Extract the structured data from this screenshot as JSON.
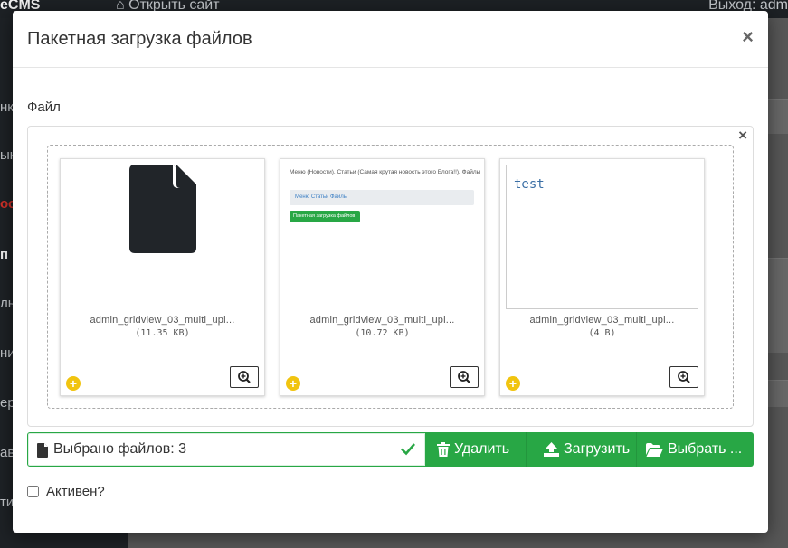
{
  "background": {
    "brand": "eCMS",
    "open_site": "Открыть сайт",
    "logout": "Выход: adm",
    "sidebar_fragments": [
      "нк",
      "ык",
      "ос",
      "п",
      "ль",
      "ни",
      "ер",
      "ав",
      "ти"
    ]
  },
  "modal": {
    "title": "Пакетная загрузка файлов",
    "close": "×"
  },
  "form": {
    "file_label": "Файл",
    "dropzone_close": "×",
    "files": [
      {
        "name": "admin_gridview_03_multi_upl...",
        "size": "(11.35 KB)",
        "preview": "file-icon"
      },
      {
        "name": "admin_gridview_03_multi_upl...",
        "size": "(10.72 KB)",
        "preview": "image",
        "preview_texts": {
          "title": "Меню (Новости). Статьи (Самая крутая новость этого Блога!!). Файлы",
          "breadcrumb": "Меню Статьи Файлы",
          "button": "Пакетная загрузка файлов"
        }
      },
      {
        "name": "admin_gridview_03_multi_upl...",
        "size": "(4 B)",
        "preview": "text",
        "preview_text": "test"
      }
    ],
    "caption": "Выбрано файлов: 3",
    "remove_label": "Удалить",
    "upload_label": "Загрузить",
    "browse_label": "Выбрать ...",
    "active_label": "Активен?"
  },
  "colors": {
    "accent_green": "#28a745",
    "plus_yellow": "#f1c40f"
  }
}
